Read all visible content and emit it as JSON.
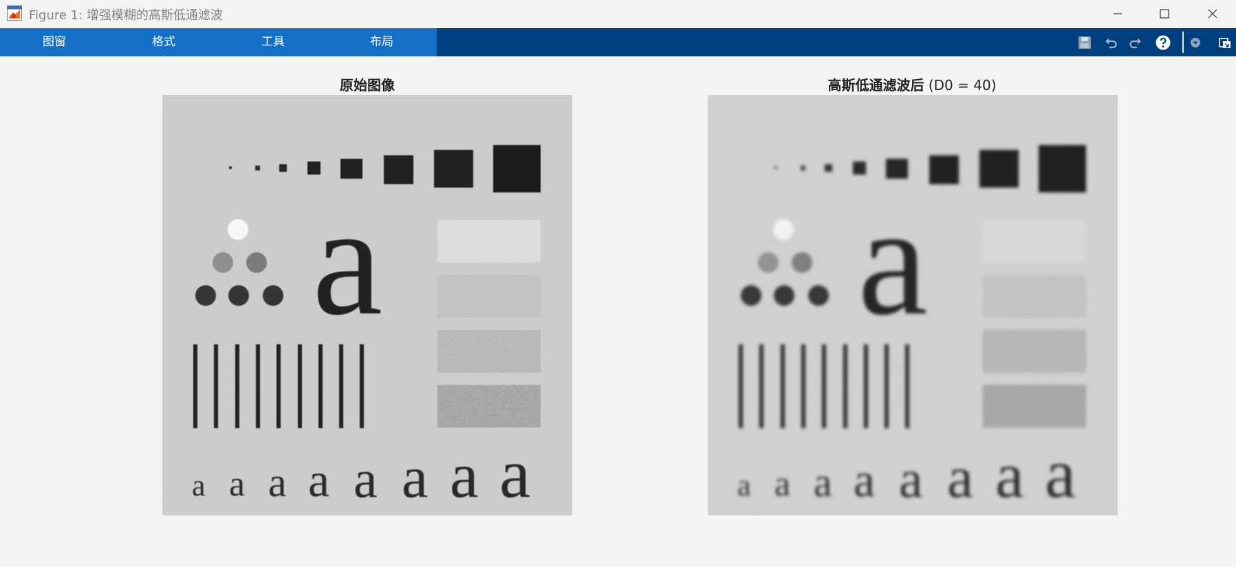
{
  "window": {
    "title": "Figure 1: 增强模糊的高斯低通滤波"
  },
  "menu": {
    "items": [
      {
        "label": "图窗"
      },
      {
        "label": "格式"
      },
      {
        "label": "工具"
      },
      {
        "label": "布局"
      }
    ]
  },
  "toolbar": {
    "icons": [
      "save-icon",
      "undo-icon",
      "redo-icon",
      "help-icon",
      "dropdown-icon",
      "undock-icon"
    ]
  },
  "axes": [
    {
      "title_main": "原始图像",
      "title_sub": ""
    },
    {
      "title_main": "高斯低通滤波后",
      "title_sub": " (D0 = 40)"
    }
  ],
  "colors": {
    "titlebar_bg": "#f3f3f3",
    "menu_bg": "#1470c4",
    "toolstrip_bg": "#003f7e",
    "figure_bg": "#f4f4f4"
  }
}
